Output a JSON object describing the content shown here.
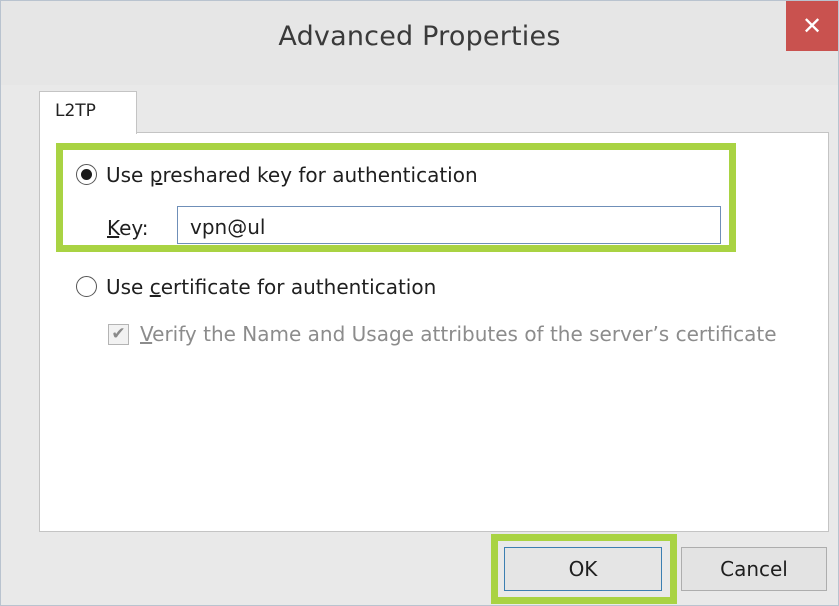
{
  "window": {
    "title": "Advanced Properties",
    "close_glyph": "✕"
  },
  "tabs": [
    {
      "label": "L2TP"
    }
  ],
  "auth": {
    "preshared": {
      "label_pre": "Use ",
      "label_key": "p",
      "label_post": "reshared key for authentication",
      "selected": true
    },
    "key": {
      "label_key": "K",
      "label_post": "ey:",
      "value": "vpn@ul"
    },
    "certificate": {
      "label_pre": "Use ",
      "label_key": "c",
      "label_post": "ertificate for authentication",
      "selected": false
    },
    "verify": {
      "label_key": "V",
      "label_post": "erify the Name and Usage attributes of the server’s certificate",
      "checked": true,
      "enabled": false
    }
  },
  "buttons": {
    "ok": "OK",
    "cancel": "Cancel"
  },
  "colors": {
    "highlight": "#a9d343",
    "close": "#c9524f"
  }
}
